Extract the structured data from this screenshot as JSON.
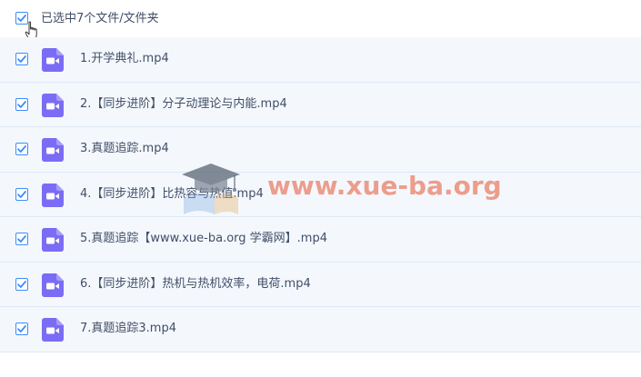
{
  "header": {
    "selection_text": "已选中7个文件/文件夹",
    "select_all_checked": true
  },
  "files": [
    {
      "name": "1.开学典礼.mp4",
      "checked": true,
      "icon": "video-file-icon"
    },
    {
      "name": "2.【同步进阶】分子动理论与内能.mp4",
      "checked": true,
      "icon": "video-file-icon"
    },
    {
      "name": "3.真题追踪.mp4",
      "checked": true,
      "icon": "video-file-icon"
    },
    {
      "name": "4.【同步进阶】比热容与热值.mp4",
      "checked": true,
      "icon": "video-file-icon"
    },
    {
      "name": "5.真题追踪【www.xue-ba.org 学霸网】.mp4",
      "checked": true,
      "icon": "video-file-icon"
    },
    {
      "name": "6.【同步进阶】热机与热机效率，电荷.mp4",
      "checked": true,
      "icon": "video-file-icon"
    },
    {
      "name": "7.真题追踪3.mp4",
      "checked": true,
      "icon": "video-file-icon"
    }
  ],
  "watermark": {
    "text": "www.xue-ba.org"
  },
  "colors": {
    "accent": "#3b8cff",
    "row_bg": "#f4f8fd",
    "text": "#424e67",
    "video_icon": "#7b6cf6",
    "watermark": "#e86c50"
  }
}
